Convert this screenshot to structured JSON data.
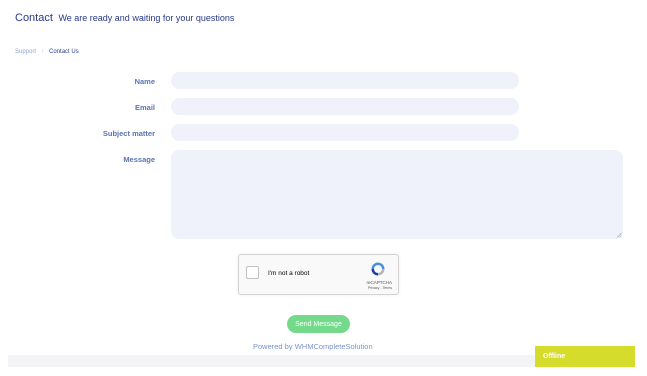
{
  "header": {
    "title": "Contact",
    "subtitle": "We are ready and waiting for your questions"
  },
  "breadcrumb": {
    "items": [
      "Support",
      "Contact Us"
    ],
    "separator": "/"
  },
  "form": {
    "name_label": "Name",
    "name_value": "",
    "email_label": "Email",
    "email_value": "",
    "subject_label": "Subject matter",
    "subject_value": "",
    "message_label": "Message",
    "message_value": ""
  },
  "recaptcha": {
    "checkbox_label": "I'm not a robot",
    "brand": "reCAPTCHA",
    "links": "Privacy - Terms",
    "checked": false
  },
  "actions": {
    "send_label": "Send Message"
  },
  "footer": {
    "powered_prefix": "Powered by ",
    "powered_link": "WHMCompleteSolution"
  },
  "chat": {
    "status": "Offline"
  },
  "colors": {
    "accent_green": "#74d98a",
    "chat_yellow": "#d5dc2b",
    "field_bg": "#eff2fb",
    "heading_blue": "#2a3a87",
    "label_blue": "#5a73b0"
  },
  "icons": [
    "recaptcha-logo-icon",
    "resize-grip-icon"
  ]
}
